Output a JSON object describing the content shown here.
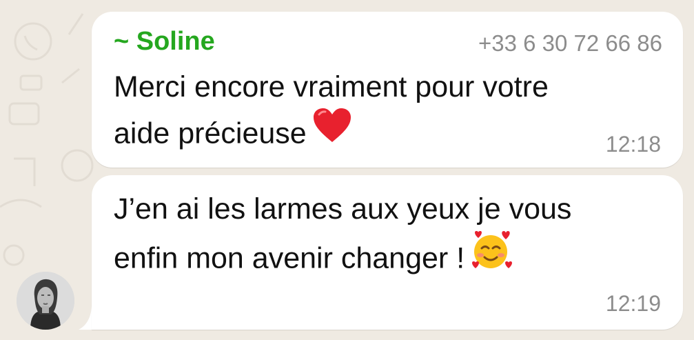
{
  "chat": {
    "background_color": "#efeae2",
    "bubble_color": "#ffffff",
    "sender_color": "#25a71f",
    "meta_color": "#8c8c8c",
    "messages": [
      {
        "sender": "~ Soline",
        "phone": "+33 6 30 72 66 86",
        "line1": "Merci encore vraiment pour votre",
        "line2": "aide précieuse",
        "emoji": "red-heart-icon",
        "time": "12:18"
      },
      {
        "line1": "J’en ai les larmes aux yeux je vous",
        "line2": "enfin mon avenir changer !",
        "emoji": "smiling-face-with-hearts-icon",
        "time": "12:19"
      }
    ],
    "avatar": "sender-avatar"
  }
}
